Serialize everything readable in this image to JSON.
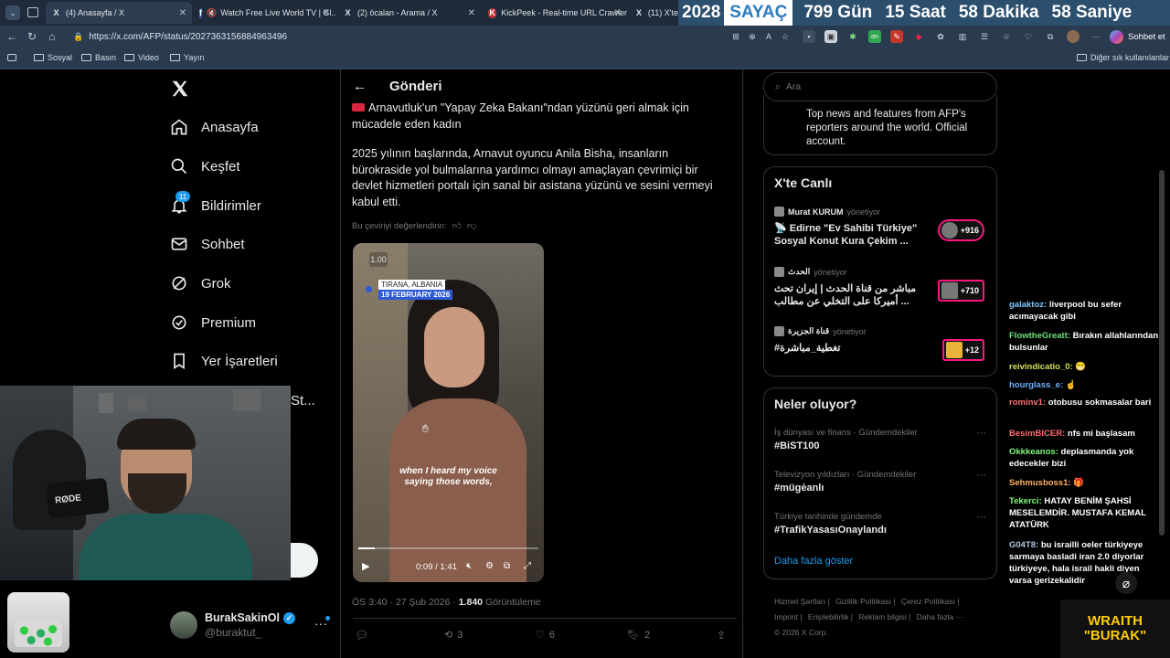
{
  "browser": {
    "tabs": [
      {
        "label": "(4) Anasayfa / X",
        "icon": "X"
      },
      {
        "label": "Watch Free Live World TV | Gl...",
        "icon": "f"
      },
      {
        "label": "(2) öcalan - Arama / X",
        "icon": "X"
      },
      {
        "label": "KickPeek - Real-time URL Crawler",
        "icon": "K"
      },
      {
        "label": "(11) X'te",
        "icon": "X"
      }
    ],
    "url": "https://x.com/AFP/status/2027363156884963496",
    "chat_button": "Sohbet et",
    "bookmarks": [
      "Sosyal",
      "Basın",
      "Video",
      "Yayın"
    ],
    "other_bookmarks": "Diğer sık kullanılanlar"
  },
  "counter": {
    "year": "2028",
    "label": "SAYAÇ",
    "days": "799 Gün",
    "hours": "15 Saat",
    "minutes": "58 Dakika",
    "seconds": "58 Saniye"
  },
  "sidebar": {
    "items": [
      {
        "label": "Anasayfa",
        "icon": "home-icon"
      },
      {
        "label": "Keşfet",
        "icon": "search-icon"
      },
      {
        "label": "Bildirimler",
        "icon": "bell-icon",
        "badge": "11"
      },
      {
        "label": "Sohbet",
        "icon": "mail-icon"
      },
      {
        "label": "Grok",
        "icon": "grok-icon"
      },
      {
        "label": "Premium",
        "icon": "premium-icon"
      },
      {
        "label": "Yer İşaretleri",
        "icon": "bookmark-icon"
      }
    ],
    "partial_label": "St...",
    "profile_name": "BurakSakinOl",
    "profile_handle": "@buraktut_"
  },
  "post": {
    "header": "Gönderi",
    "text1": "Arnavutluk'un \"Yapay Zeka Bakanı\"ndan yüzünü geri almak için mücadele eden kadın",
    "text2": "2025 yılının başlarında, Arnavut oyuncu Anila Bisha, insanların bürokraside yol bulmalarına yardımcı olmayı amaçlayan çevrimiçi bir devlet hizmetleri portalı için sanal bir asistana yüzünü ve sesini vermeyi kabul etti.",
    "rate_translation": "Bu çeviriyi değerlendirin:",
    "video_speed": "1.00",
    "video_location": "TIRANA, ALBANIA",
    "video_date": "19 FEBRUARY 2026",
    "video_subtitle_line1": "when I heard my voice",
    "video_subtitle_line2": "saying those words,",
    "video_time": "0:09 / 1:41",
    "video_progress": 0.09,
    "timestamp": "ÖS 3:40 · 27 Şub 2026 ·",
    "views_count": "1.840",
    "views_label": "Görüntüleme",
    "retweets": "3",
    "likes": "6",
    "bookmarks": "2"
  },
  "right": {
    "search_placeholder": "Ara",
    "afp_bio": "Top news and features from AFP's reporters around the world. Official account.",
    "live_title": "X'te Canlı",
    "live": [
      {
        "host": "Murat KURUM",
        "status": "yönetiyor",
        "title": "📡 Edirne \"Ev Sahibi Türkiye\" Sosyal Konut Kura Çekim ...",
        "count": "+916"
      },
      {
        "host": "الحدث",
        "status": "yönetiyor",
        "title": "مباشر من قناة الحدث | إيران تحث أميركا على التخلي عن مطالب ...",
        "count": "+710"
      },
      {
        "host": "قناة الجزيرة",
        "status": "yönetiyor",
        "title": "#تغطية_مباشرة",
        "count": "+12"
      }
    ],
    "trends_title": "Neler oluyor?",
    "trends": [
      {
        "category": "İş dünyası ve finans · Gündemdekiler",
        "name": "#BiST100"
      },
      {
        "category": "Televizyon yıldızları · Gündemdekiler",
        "name": "#mügėanlı"
      },
      {
        "category": "Türkiye tarihinde gündemde",
        "name": "#TrafikYasasıOnaylandı"
      }
    ],
    "show_more": "Daha fazla göster",
    "footer": [
      "Hizmet Şartları",
      "Gizlilik Politikası",
      "Çerez Politikası",
      "Imprint",
      "Erişilebilirlik",
      "Reklam bilgisi",
      "Daha fazla ···",
      "© 2026 X Corp."
    ]
  },
  "chat": [
    {
      "user": "galaktoz:",
      "msg": "liverpool bu sefer acımayacak gibi",
      "color": "#7ec8ff"
    },
    {
      "user": "FlowtheGreatt:",
      "msg": "Bırakın allahlarından bulsunlar",
      "color": "#6ee07a"
    },
    {
      "user": "reivindicatio_0:",
      "msg": "😁",
      "color": "#d6e05a"
    },
    {
      "user": "hourglass_e:",
      "msg": "☝",
      "color": "#6fb0ff"
    },
    {
      "user": "rominv1:",
      "msg": "otobusu sokmasalar bari",
      "color": "#ff7070"
    },
    {
      "user": "BesimBICER:",
      "msg": "nfs mi başlasam",
      "color": "#ff6b6b"
    },
    {
      "user": "Okkkeanos:",
      "msg": "deplasmanda yok edecekler bizi",
      "color": "#7cfc7c"
    },
    {
      "user": "Sehmusboss1:",
      "msg": "🎁",
      "color": "#ffb060"
    },
    {
      "user": "Tekerci:",
      "msg": "HATAY BENİM ŞAHSİ MESELEMDİR. MUSTAFA KEMAL ATATÜRK",
      "color": "#7cfc7c"
    },
    {
      "user": "G04T8:",
      "msg": "bu israilli oeler türkiyeye sarmaya basladi iran 2.0 diyorlar türkiyeye, hala israil hakli diyen varsa gerizekalidir",
      "color": "#b0c4de"
    }
  ],
  "stream": {
    "logo_line1": "WRAITH",
    "logo_line2": "\"BURAK\""
  }
}
